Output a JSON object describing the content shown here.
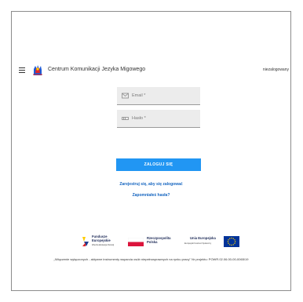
{
  "header": {
    "app_title": "Centrum Komunikacji Jezyka Migowego",
    "login_status": "niezalogowany"
  },
  "form": {
    "email_placeholder": "Email *",
    "password_placeholder": "Hasło *",
    "login_button": "ZALOGUJ SIĘ",
    "register_link": "Zarejestruj się, aby się zalogować",
    "forgot_link": "Zapomniałeś hasła?"
  },
  "sponsors": {
    "fe_title_1": "Fundusze",
    "fe_title_2": "Europejskie",
    "fe_sub": "Wiedza Edukacja Rozwój",
    "pl_title_1": "Rzeczpospolita",
    "pl_title_2": "Polska",
    "ue_title": "Unia Europejska",
    "ue_sub": "Europejski Fundusz Społeczny"
  },
  "project_note": "„Włączenie wyłączonych - aktywne instrumenty wsparcia osób niepełnosprawnych na rynku pracy\" Nr projektu: POWR.02.06.00-00-0065/19",
  "colors": {
    "primary": "#2196f3",
    "link": "#1565c0",
    "eu_blue": "#003399",
    "eu_star": "#ffcc00",
    "polish_red": "#dc143c"
  },
  "icons": {
    "menu": "hamburger-icon",
    "logo": "hand-logo",
    "email": "envelope-icon",
    "password": "key-icon"
  }
}
